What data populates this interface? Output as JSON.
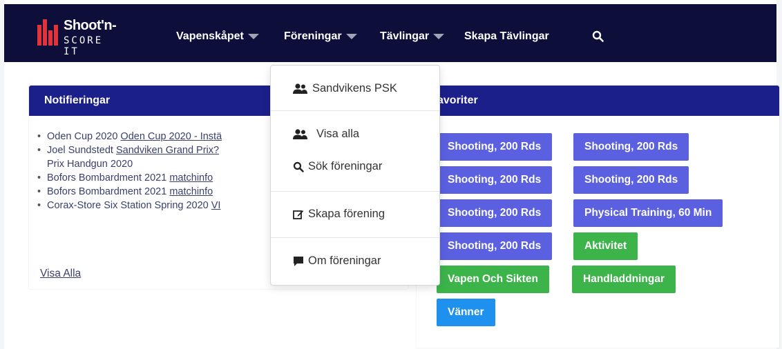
{
  "brand": {
    "line1": "Shoot'n-",
    "line2": "SCORE IT",
    "accent_color": "#e0343a"
  },
  "nav": {
    "items": [
      {
        "label": "Vapenskåpet",
        "has_caret": true
      },
      {
        "label": "Föreningar",
        "has_caret": true
      },
      {
        "label": "Tävlingar",
        "has_caret": true
      },
      {
        "label": "Skapa Tävlingar",
        "has_caret": false
      }
    ],
    "search_icon": "search-icon",
    "background": "#0d0f3a"
  },
  "dropdown": {
    "items": [
      {
        "label": "Sandvikens PSK",
        "icon": "users-icon"
      },
      {
        "label": "Visa alla",
        "icon": "users-icon"
      },
      {
        "label": "Sök föreningar",
        "icon": "search-icon"
      },
      {
        "label": "Skapa förening",
        "icon": "edit-icon"
      },
      {
        "label": "Om föreningar",
        "icon": "comment-icon"
      }
    ]
  },
  "notifications": {
    "title": "Notifieringar",
    "items": [
      {
        "prefix": "Oden Cup 2020 ",
        "link": "Oden Cup 2020 - Instä"
      },
      {
        "prefix": "Joel Sundstedt ",
        "link": "Sandviken Grand Prix?",
        "line2": "Prix Handgun 2020"
      },
      {
        "prefix": "Bofors Bombardment 2021 ",
        "link": "matchinfo"
      },
      {
        "prefix": "Bofors Bombardment 2021 ",
        "link": "matchinfo"
      },
      {
        "prefix": "Corax-Store Six Station Spring 2020 ",
        "link": "VI"
      }
    ],
    "view_all": "Visa Alla"
  },
  "favorites": {
    "title": "avoriter",
    "chips": [
      {
        "label": "Shooting, 200 Rds",
        "color": "blue"
      },
      {
        "label": "Shooting, 200 Rds",
        "color": "blue"
      },
      {
        "label": "Shooting, 200 Rds",
        "color": "blue"
      },
      {
        "label": "Shooting, 200 Rds",
        "color": "blue"
      },
      {
        "label": "Shooting, 200 Rds",
        "color": "blue"
      },
      {
        "label": "Physical Training, 60 Min",
        "color": "blue"
      },
      {
        "label": "Shooting, 200 Rds",
        "color": "blue"
      },
      {
        "label": "Aktivitet",
        "color": "green"
      },
      {
        "label": "Vapen Och Sikten",
        "color": "green"
      },
      {
        "label": "Handladdningar",
        "color": "green"
      },
      {
        "label": "Vänner",
        "color": "sky"
      }
    ],
    "colors": {
      "blue": "#5b60e0",
      "green": "#3cb44a",
      "sky": "#1e90ee"
    }
  }
}
